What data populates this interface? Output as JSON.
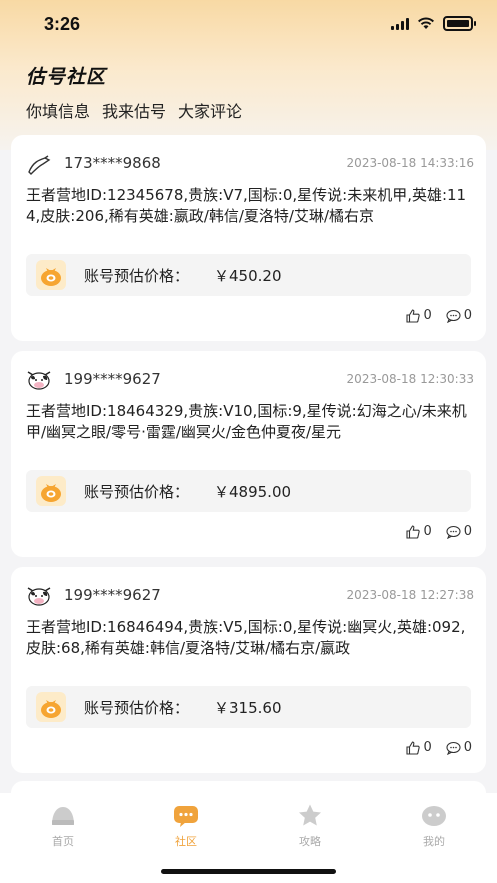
{
  "status_bar": {
    "time": "3:26"
  },
  "header": {
    "title": "估号社区",
    "tabs": [
      "你填信息",
      "我来估号",
      "大家评论"
    ]
  },
  "price_label": "账号预估价格：",
  "posts": [
    {
      "phone": "173****9868",
      "time": "2023-08-18 14:33:16",
      "info": "王者营地ID:12345678,贵族:V7,国标:0,星传说:未来机甲,英雄:114,皮肤:206,稀有英雄:嬴政/韩信/夏洛特/艾琳/橘右京",
      "price": "￥450.20",
      "likes": "0",
      "comments": "0"
    },
    {
      "phone": "199****9627",
      "time": "2023-08-18 12:30:33",
      "info": "王者营地ID:18464329,贵族:V10,国标:9,星传说:幻海之心/未来机甲/幽冥之眼/零号·雷霆/幽冥火/金色仲夏夜/星元",
      "price": "￥4895.00",
      "likes": "0",
      "comments": "0"
    },
    {
      "phone": "199****9627",
      "time": "2023-08-18 12:27:38",
      "info": "王者营地ID:16846494,贵族:V5,国标:0,星传说:幽冥火,英雄:092,皮肤:68,稀有英雄:韩信/夏洛特/艾琳/橘右京/嬴政",
      "price": "￥315.60",
      "likes": "0",
      "comments": "0"
    }
  ],
  "tabbar": [
    {
      "label": "首页",
      "icon": "home-icon"
    },
    {
      "label": "社区",
      "icon": "chat-bubble-icon",
      "active": true
    },
    {
      "label": "攻略",
      "icon": "star-icon"
    },
    {
      "label": "我的",
      "icon": "profile-icon"
    }
  ],
  "colors": {
    "accent": "#f0a33c",
    "inactive": "#cccccc",
    "header_gradient_top": "#f8d9a4"
  }
}
